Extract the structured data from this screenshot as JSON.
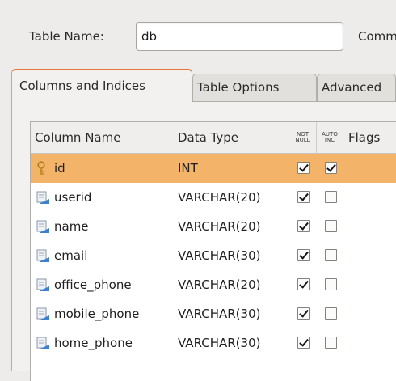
{
  "table_name": {
    "label": "Table Name:",
    "value": "db",
    "comment_label": "Comment"
  },
  "tabs": [
    {
      "label": "Columns and Indices",
      "active": true
    },
    {
      "label": "Table Options",
      "active": false
    },
    {
      "label": "Advanced",
      "active": false
    }
  ],
  "grid": {
    "headers": {
      "column_name": "Column Name",
      "data_type": "Data Type",
      "not_null_1": "NOT",
      "not_null_2": "NULL",
      "auto_inc_1": "AUTO",
      "auto_inc_2": "INC",
      "flags": "Flags"
    },
    "rows": [
      {
        "name": "id",
        "type": "INT",
        "not_null": true,
        "auto_inc": true,
        "icon": "key-icon",
        "selected": true
      },
      {
        "name": "userid",
        "type": "VARCHAR(20)",
        "not_null": true,
        "auto_inc": false,
        "icon": "column-icon",
        "selected": false
      },
      {
        "name": "name",
        "type": "VARCHAR(20)",
        "not_null": true,
        "auto_inc": false,
        "icon": "column-icon",
        "selected": false
      },
      {
        "name": "email",
        "type": "VARCHAR(30)",
        "not_null": true,
        "auto_inc": false,
        "icon": "column-icon",
        "selected": false
      },
      {
        "name": "office_phone",
        "type": "VARCHAR(20)",
        "not_null": true,
        "auto_inc": false,
        "icon": "column-icon",
        "selected": false
      },
      {
        "name": "mobile_phone",
        "type": "VARCHAR(30)",
        "not_null": true,
        "auto_inc": false,
        "icon": "column-icon",
        "selected": false
      },
      {
        "name": "home_phone",
        "type": "VARCHAR(30)",
        "not_null": true,
        "auto_inc": false,
        "icon": "column-icon",
        "selected": false
      }
    ]
  },
  "colors": {
    "selected_row": "#f3b46a",
    "active_tab_accent": "#e8763a",
    "key_icon": "#d19a2e",
    "column_icon": "#4a7fc0"
  }
}
